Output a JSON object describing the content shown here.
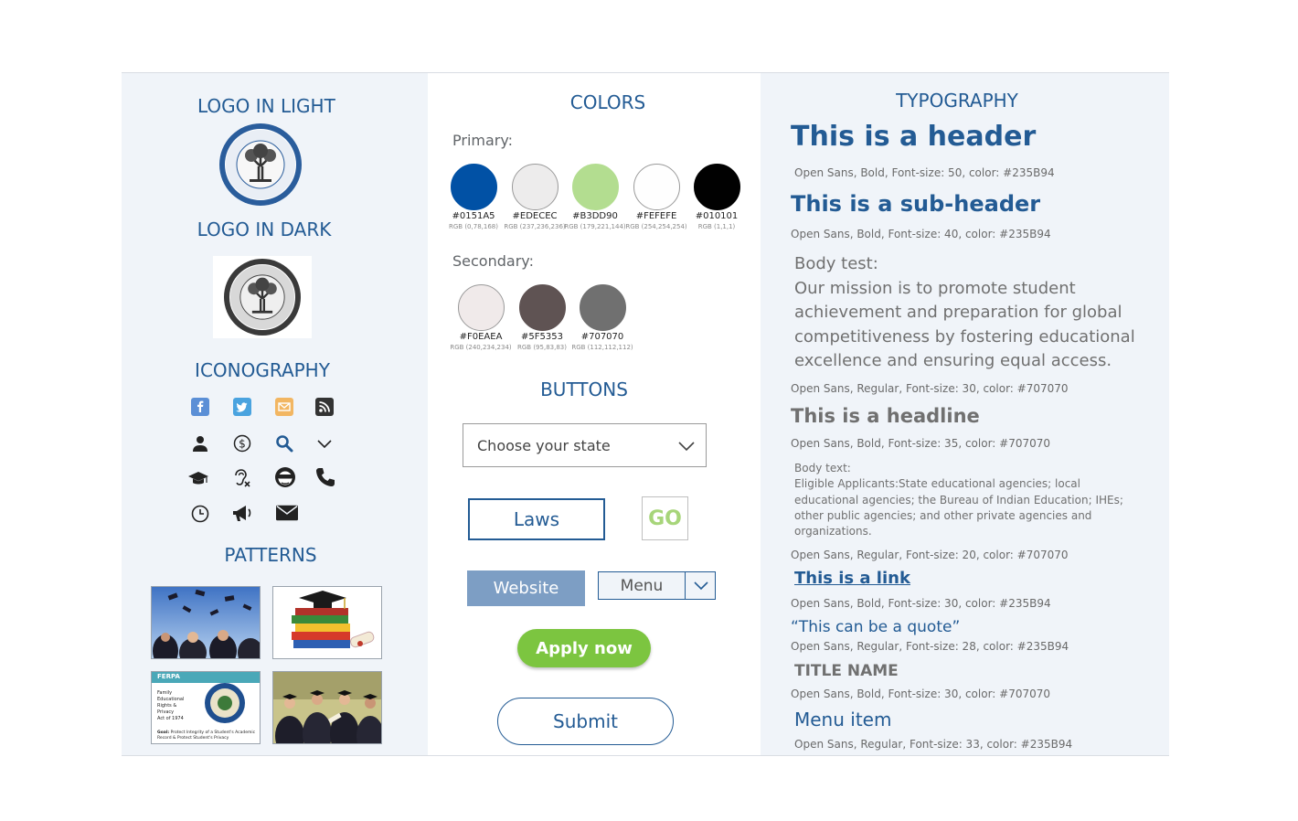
{
  "sections": {
    "logo_light": "LOGO IN LIGHT",
    "logo_dark": "LOGO IN DARK",
    "iconography": "ICONOGRAPHY",
    "patterns": "PATTERNS",
    "colors": "COLORS",
    "buttons": "BUTTONS",
    "typography": "TYPOGRAPHY"
  },
  "logo": {
    "ring_text": "DEPARTMENT OF EDUCATION",
    "bottom_text": "UNITED STATES OF AMERICA"
  },
  "icons": [
    "facebook-icon",
    "twitter-icon",
    "email-icon",
    "rss-icon",
    "user-icon",
    "dollar-icon",
    "search-icon",
    "chevron-down-icon",
    "graduation-cap-icon",
    "hearing-impaired-icon",
    "anonymous-icon",
    "phone-icon",
    "clock-icon",
    "megaphone-icon",
    "envelope-icon"
  ],
  "patterns": {
    "ferpa_card": {
      "header": "FERPA",
      "lines": [
        "Family",
        "Educational",
        "Rights &",
        "Privacy",
        "Act of 1974"
      ],
      "goal_label": "Goal:",
      "goal_text": "Protect Integrity of a Student's Academic Record & Protect Student's Privacy"
    }
  },
  "colors": {
    "primary_label": "Primary:",
    "secondary_label": "Secondary:",
    "primary": [
      {
        "hex": "#0151A5",
        "rgb": "RGB (0,78,168)",
        "color": "#0151a5"
      },
      {
        "hex": "#EDECEC",
        "rgb": "RGB (237,236,236)",
        "color": "#edecec"
      },
      {
        "hex": "#B3DD90",
        "rgb": "RGB (179,221,144)",
        "color": "#b3dd90"
      },
      {
        "hex": "#FEFEFE",
        "rgb": "RGB (254,254,254)",
        "color": "#fefefe"
      },
      {
        "hex": "#010101",
        "rgb": "RGB (1,1,1)",
        "color": "#010101"
      }
    ],
    "secondary": [
      {
        "hex": "#F0EAEA",
        "rgb": "RGB (240,234,234)",
        "color": "#f0eaea"
      },
      {
        "hex": "#5F5353",
        "rgb": "RGB (95,83,83)",
        "color": "#5f5353"
      },
      {
        "hex": "#707070",
        "rgb": "RGB (112,112,112)",
        "color": "#707070"
      }
    ]
  },
  "buttons": {
    "state_select": "Choose your state",
    "laws": "Laws",
    "go": "GO",
    "website": "Website",
    "menu": "Menu",
    "apply": "Apply now",
    "submit": "Submit"
  },
  "typography": {
    "header": "This is a header",
    "header_meta": "Open Sans, Bold, Font-size: 50, color: #235B94",
    "subheader": "This is a sub-header",
    "subheader_meta": "Open Sans, Bold, Font-size: 40, color: #235B94",
    "body_label": "Body test:",
    "body_lines": [
      "Our mission is to promote student",
      "achievement and preparation for global",
      "competitiveness by fostering educational",
      "excellence and ensuring equal access."
    ],
    "body_meta": "Open Sans, Regular, Font-size: 30, color: #707070",
    "headline": "This is a headline",
    "headline_meta": "Open Sans, Bold, Font-size: 35, color: #707070",
    "small_label": "Body text:",
    "small_lines": [
      "Eligible Applicants:State educational agencies; local",
      "educational agencies; the Bureau of Indian Education; IHEs;",
      "other public agencies; and other private agencies and",
      "organizations."
    ],
    "small_meta": "Open Sans, Regular, Font-size: 20, color: #707070",
    "link": "This is a link",
    "link_meta": "Open Sans, Bold, Font-size: 30, color: #235B94",
    "quote": "“This can be a quote”",
    "quote_meta": "Open Sans, Regular, Font-size: 28, color: #235B94",
    "title_name": "TITLE NAME",
    "title_meta": "Open Sans, Bold, Font-size: 30, color: #707070",
    "menu_item": "Menu item",
    "menu_meta": "Open Sans, Regular, Font-size: 33, color: #235B94"
  },
  "theme": {
    "brand_blue": "#235b94",
    "text_gray": "#707070",
    "accent_green": "#7cc540",
    "panel_bg": "#f0f4f9"
  }
}
